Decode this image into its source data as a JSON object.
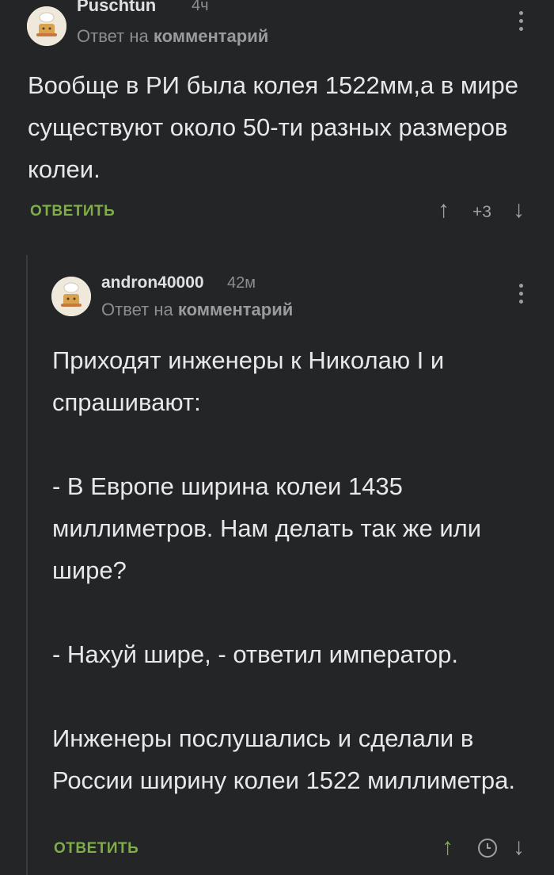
{
  "comments": [
    {
      "author": "Puschtun",
      "time": "4ч",
      "reply_prefix": "Ответ на",
      "reply_target": "комментарий",
      "paragraphs": [
        "Вообще в РИ была колея 1522мм,а в мире существуют около 50-ти разных размеров колеи."
      ],
      "reply_label": "ОТВЕТИТЬ",
      "score": "+3",
      "upvote_icon": "↑",
      "downvote_icon": "↓"
    },
    {
      "author": "andron40000",
      "time": "42м",
      "reply_prefix": "Ответ на",
      "reply_target": "комментарий",
      "paragraphs": [
        "Приходят инженеры к Николаю I и спрашивают:",
        "- В Европе ширина колеи 1435 миллиметров. Нам делать так же или шире?",
        "- Нахуй шире, - ответил император.",
        "Инженеры послушались и сделали в России ширину колеи 1522 миллиметра."
      ],
      "reply_label": "ОТВЕТИТЬ",
      "upvote_icon": "↑",
      "downvote_icon": "↓"
    }
  ],
  "colors": {
    "background": "#242527",
    "accent_green": "#7fae46",
    "muted": "#8c8d90"
  }
}
